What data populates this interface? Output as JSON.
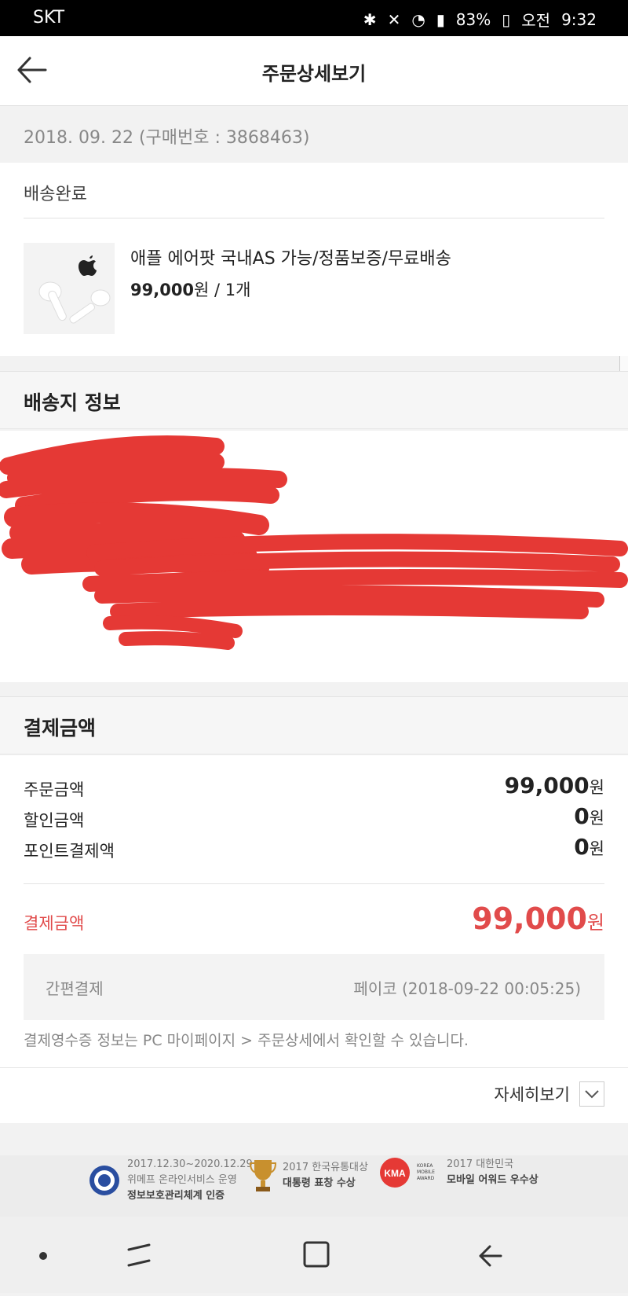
{
  "status_bar": {
    "carrier": "SKT",
    "battery": "83%",
    "ampm": "오전",
    "time": "9:32"
  },
  "header": {
    "title": "주문상세보기"
  },
  "order": {
    "date_line": "2018. 09. 22 (구매번호 : 3868463)",
    "status": "배송완료",
    "product_name": "애플 에어팟 국내AS 가능/정품보증/무료배송",
    "price": "99,000",
    "price_unit": "원",
    "quantity": " / 1개"
  },
  "shipping": {
    "title": "배송지 정보"
  },
  "payment": {
    "title": "결제금액",
    "rows": [
      {
        "label": "주문금액",
        "value": "99,000",
        "unit": "원"
      },
      {
        "label": "할인금액",
        "value": "0",
        "unit": "원"
      },
      {
        "label": "포인트결제액",
        "value": "0",
        "unit": "원"
      }
    ],
    "total_label": "결제금액",
    "total_value": "99,000",
    "total_unit": "원",
    "method_label": "간편결제",
    "method_value": "페이코 (2018-09-22 00:05:25)",
    "receipt_note": "결제영수증 정보는 PC 마이페이지 > 주문상세에서 확인할 수 있습니다.",
    "more_label": "자세히보기"
  },
  "footer": {
    "award1_line1": "2017.12.30~2020.12.29",
    "award1_line2": "위메프 온라인서비스 운영",
    "award1_line3": "정보보호관리체계 인증",
    "award2_line1": "2017 한국유통대상",
    "award2_line2": "대통령 표창 수상",
    "award3_logo": "KMA",
    "award3_line1": "2017 대한민국",
    "award3_line2": "모바일 어워드 우수상"
  },
  "colors": {
    "accent": "#e14b4b",
    "redaction": "#e53935"
  },
  "icons": [
    "back-arrow-icon",
    "chevron-down-icon",
    "apple-logo-icon",
    "trophy-icon",
    "seal-icon"
  ]
}
